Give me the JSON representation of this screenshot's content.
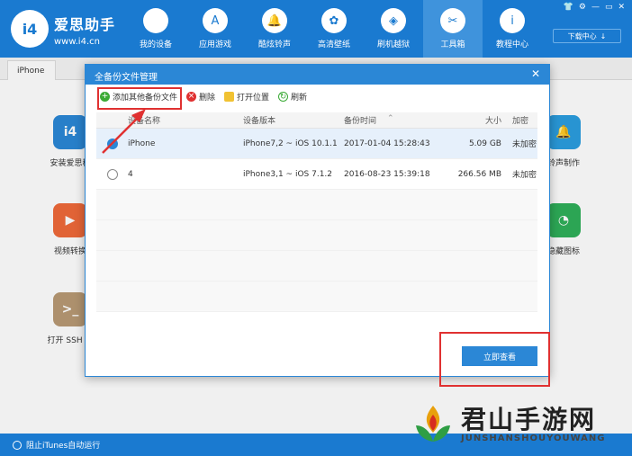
{
  "header": {
    "brand_name": "爱思助手",
    "brand_url": "www.i4.cn",
    "logo_text": "i4",
    "nav": [
      {
        "label": "我的设备",
        "icon": "apple-icon"
      },
      {
        "label": "应用游戏",
        "icon": "app-store-icon"
      },
      {
        "label": "酷炫铃声",
        "icon": "bell-icon"
      },
      {
        "label": "高清壁纸",
        "icon": "flower-icon"
      },
      {
        "label": "刷机越狱",
        "icon": "dropbox-icon"
      },
      {
        "label": "工具箱",
        "icon": "tools-icon"
      },
      {
        "label": "教程中心",
        "icon": "info-icon"
      }
    ],
    "active_nav": "工具箱",
    "download_label": "下载中心"
  },
  "tab": {
    "label": "iPhone"
  },
  "tools": {
    "install": "安装爱思移",
    "video": "视频转换",
    "ssh": "打开 SSH 通",
    "ringtone": "铃声制作",
    "hide_icon": "隐藏图标"
  },
  "dialog": {
    "title": "全备份文件管理",
    "toolbar": {
      "add": "添加其他备份文件",
      "delete": "删除",
      "open_location": "打开位置",
      "refresh": "刷新"
    },
    "columns": {
      "name": "设备名称",
      "version": "设备版本",
      "time": "备份时间",
      "size": "大小",
      "encrypted": "加密"
    },
    "rows": [
      {
        "name": "iPhone",
        "version": "iPhone7,2 ~ iOS 10.1.1",
        "time": "2017-01-04 15:28:43",
        "size": "5.09 GB",
        "encrypted": "未加密",
        "selected": true
      },
      {
        "name": "4",
        "version": "iPhone3,1 ~ iOS 7.1.2",
        "time": "2016-08-23 15:39:18",
        "size": "266.56 MB",
        "encrypted": "未加密",
        "selected": false
      }
    ],
    "view_button": "立即查看"
  },
  "statusbar": {
    "itunes_label": "阻止iTunes自动运行"
  },
  "watermark": {
    "cn": "君山手游网",
    "en": "JUNSHANSHOUYOUWANG"
  },
  "colors": {
    "primary": "#1a7ad0",
    "dialog_accent": "#2b87d6",
    "highlight": "#e03131"
  }
}
